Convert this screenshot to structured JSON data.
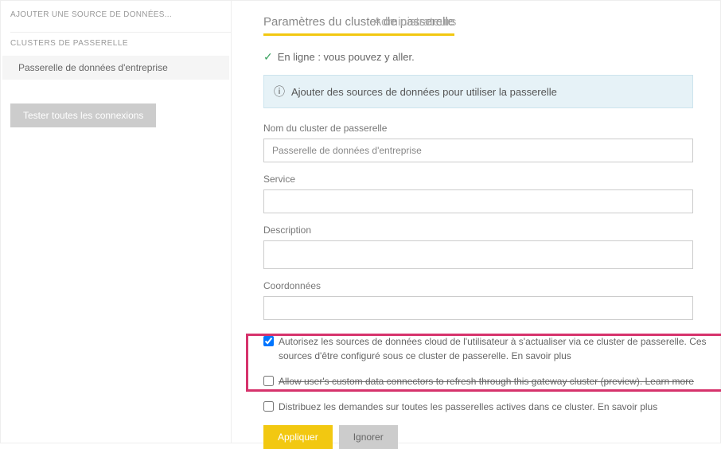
{
  "sidebar": {
    "add_source": "AJOUTER UNE SOURCE DE DONNÉES...",
    "clusters_label": "CLUSTERS DE PASSERELLE",
    "gateway_item": "Passerelle de données d'entreprise",
    "test_btn": "Tester toutes les connexions"
  },
  "tabs": {
    "settings": "Paramètres du cluster de passerelle",
    "admins": "Administrateurs"
  },
  "status": {
    "text": "En ligne : vous pouvez y aller."
  },
  "banner": {
    "text": "Ajouter des sources de données pour utiliser la passerelle"
  },
  "fields": {
    "name_label": "Nom du cluster de passerelle",
    "name_value": "Passerelle de données d'entreprise",
    "service_label": "Service",
    "service_value": "",
    "desc_label": "Description",
    "desc_value": "",
    "coords_label": "Coordonnées",
    "coords_value": ""
  },
  "checkboxes": {
    "allow_cloud": "Autorisez les sources de données cloud de l'utilisateur à s'actualiser via ce cluster de passerelle. Ces sources d'être configuré sous ce cluster de passerelle. En savoir plus",
    "allow_custom": "Allow user's custom data connectors to refresh through this gateway cluster (preview). ",
    "allow_custom_link": "Learn more",
    "distribute": "Distribuez les demandes sur toutes les passerelles actives dans ce cluster. En savoir plus"
  },
  "buttons": {
    "apply": "Appliquer",
    "ignore": "Ignorer"
  }
}
